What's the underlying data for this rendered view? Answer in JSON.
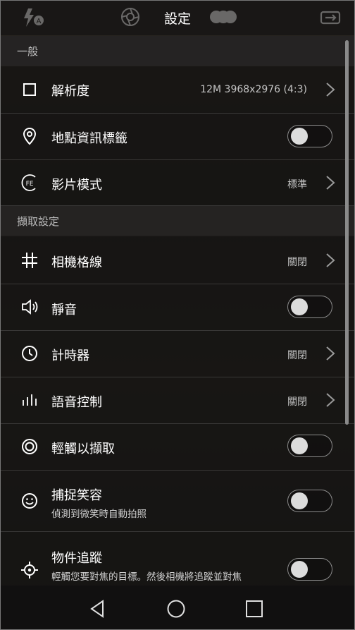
{
  "header": {
    "title": "設定"
  },
  "sections": {
    "general": "一般",
    "capture": "擷取設定"
  },
  "rows": {
    "resolution": {
      "label": "解析度",
      "value": "12M 3968x2976 (4:3)"
    },
    "location_tag": {
      "label": "地點資訊標籤",
      "toggle": false
    },
    "video_mode": {
      "label": "影片模式",
      "value": "標準"
    },
    "grid": {
      "label": "相機格線",
      "value": "關閉"
    },
    "mute": {
      "label": "靜音",
      "toggle": false
    },
    "timer": {
      "label": "計時器",
      "value": "關閉"
    },
    "voice_control": {
      "label": "語音控制",
      "value": "關閉"
    },
    "touch_capture": {
      "label": "輕觸以擷取",
      "toggle": false
    },
    "smile_capture": {
      "label": "捕捉笑容",
      "sub": "偵測到微笑時自動拍照",
      "toggle": false
    },
    "object_tracking": {
      "label": "物件追蹤",
      "sub": "輕觸您要對焦的目標。然後相機將追蹤並對焦",
      "toggle": false
    }
  },
  "icons": {
    "top": [
      "flash-auto-icon",
      "aperture-icon",
      "filter-icon",
      "switch-camera-icon"
    ],
    "nav": [
      "back-icon",
      "home-icon",
      "recents-icon"
    ]
  }
}
